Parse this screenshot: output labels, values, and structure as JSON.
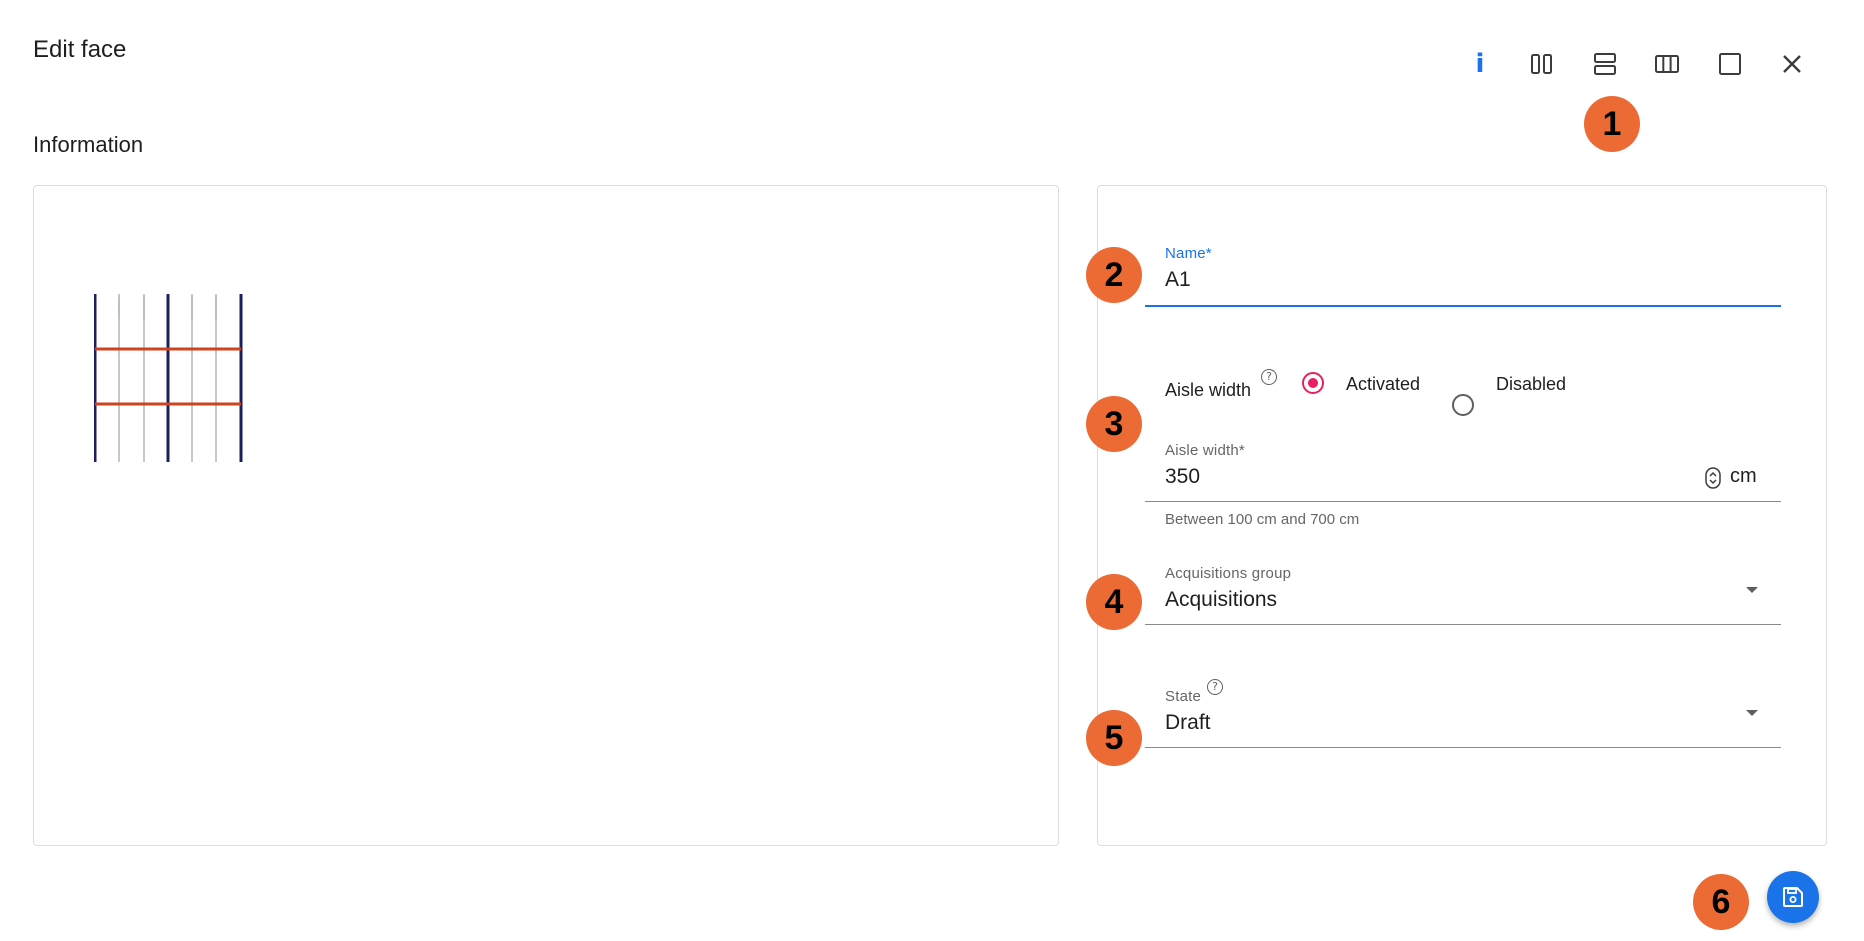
{
  "header": {
    "title": "Edit face"
  },
  "section": {
    "title": "Information"
  },
  "toolbar": {
    "items": [
      {
        "icon": "info-icon"
      },
      {
        "icon": "two-columns-icon"
      },
      {
        "icon": "two-rows-icon"
      },
      {
        "icon": "three-columns-icon"
      },
      {
        "icon": "single-pane-icon"
      },
      {
        "icon": "close-icon"
      }
    ]
  },
  "badges": {
    "b1": "1",
    "b2": "2",
    "b3": "3",
    "b4": "4",
    "b5": "5",
    "b6": "6"
  },
  "form": {
    "name": {
      "label": "Name*",
      "value": "A1"
    },
    "aisle_toggle": {
      "label": "Aisle width",
      "options": [
        "Activated",
        "Disabled"
      ],
      "selected": "Activated"
    },
    "aisle_width": {
      "label": "Aisle width*",
      "value": "350",
      "unit": "cm",
      "hint": "Between 100 cm and 700 cm"
    },
    "acquisitions_group": {
      "label": "Acquisitions group",
      "value": "Acquisitions"
    },
    "state": {
      "label": "State",
      "value": "Draft"
    }
  },
  "colors": {
    "accent": "#1a73e8",
    "radio": "#e91e63",
    "badge": "#ec6a34",
    "rack_upright": "#1c1f5e",
    "rack_beam": "#d0431f"
  }
}
